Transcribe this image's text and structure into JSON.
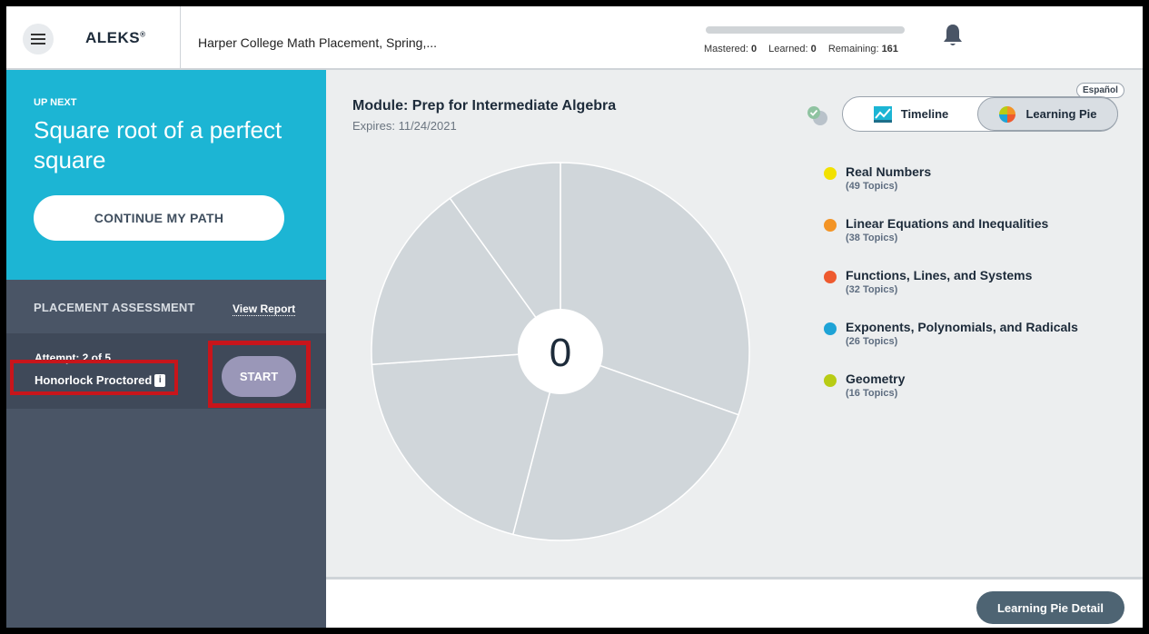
{
  "header": {
    "logo": "ALEKS",
    "logo_mark": "®",
    "course_title": "Harper College Math Placement, Spring,...",
    "progress": {
      "mastered_label": "Mastered:",
      "mastered_value": "0",
      "learned_label": "Learned:",
      "learned_value": "0",
      "remaining_label": "Remaining:",
      "remaining_value": "161",
      "fill_fraction": 0
    },
    "icons": {
      "menu": "hamburger-icon",
      "notifications": "bell-icon"
    }
  },
  "sidebar": {
    "up_next_label": "UP NEXT",
    "up_next_topic": "Square root of a perfect square",
    "continue_label": "CONTINUE MY PATH",
    "placement_label": "PLACEMENT ASSESSMENT",
    "view_report_label": "View Report",
    "attempt_text": "Attempt: 2 of 5",
    "honorlock_label": "Honorlock Proctored",
    "info_icon_glyph": "i",
    "start_label": "START"
  },
  "main": {
    "module_title": "Module: Prep for Intermediate Algebra",
    "expires": "Expires: 11/24/2021",
    "language_label": "Español",
    "tabs": {
      "timeline_label": "Timeline",
      "learning_pie_label": "Learning Pie",
      "active": "Learning Pie"
    },
    "pie_center_value": "0",
    "legend": [
      {
        "name": "Real Numbers",
        "count": "(49 Topics)",
        "color": "#f2e100"
      },
      {
        "name": "Linear Equations and Inequalities",
        "count": "(38 Topics)",
        "color": "#f39426"
      },
      {
        "name": "Functions, Lines, and Systems",
        "count": "(32 Topics)",
        "color": "#ee5a2f"
      },
      {
        "name": "Exponents, Polynomials, and Radicals",
        "count": "(26 Topics)",
        "color": "#1ea3d6"
      },
      {
        "name": "Geometry",
        "count": "(16 Topics)",
        "color": "#b8cc14"
      }
    ],
    "pie_fill_color": "#d0d6da",
    "pie_line_color": "#ffffff"
  },
  "footer": {
    "learning_pie_detail_label": "Learning Pie Detail"
  }
}
